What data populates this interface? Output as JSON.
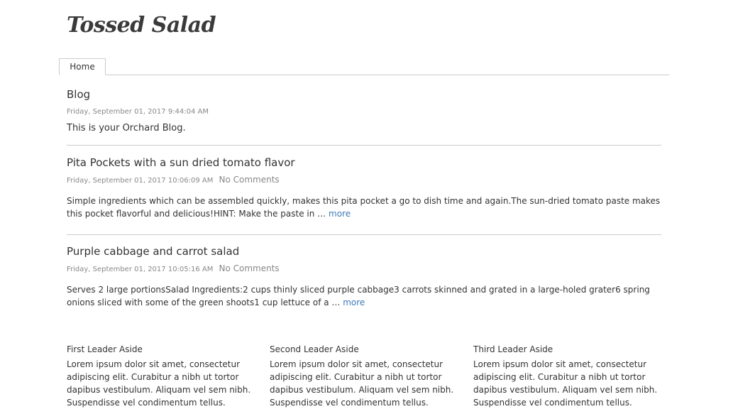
{
  "site": {
    "title": "Tossed Salad"
  },
  "nav": {
    "tabs": [
      {
        "label": "Home"
      }
    ]
  },
  "blog": {
    "title": "Blog",
    "date": "Friday, September 01, 2017 9:44:04 AM",
    "description": "This is your Orchard Blog."
  },
  "posts": [
    {
      "title": "Pita Pockets with a sun dried tomato flavor",
      "date": "Friday, September 01, 2017 10:06:09 AM",
      "comments": "No Comments",
      "excerpt": "Simple ingredients which can be assembled quickly, makes this pita pocket a go to dish time and again.The sun-dried tomato paste makes this pocket flavorful and delicious!HINT:  Make the paste in … ",
      "more": "more"
    },
    {
      "title": "Purple cabbage and carrot salad",
      "date": "Friday, September 01, 2017 10:05:16 AM",
      "comments": "No Comments",
      "excerpt": "Serves 2 large portionsSalad Ingredients:2 cups thinly sliced purple cabbage3 carrots skinned and grated in a large-holed grater6 spring onions sliced with some of the green shoots1 cup lettuce of a … ",
      "more": "more"
    }
  ],
  "asides": [
    {
      "title": "First Leader Aside",
      "body": "Lorem ipsum dolor sit amet, consectetur adipiscing elit. Curabitur a nibh ut tortor dapibus vestibulum. Aliquam vel sem nibh. Suspendisse vel condimentum tellus."
    },
    {
      "title": "Second Leader Aside",
      "body": "Lorem ipsum dolor sit amet, consectetur adipiscing elit. Curabitur a nibh ut tortor dapibus vestibulum. Aliquam vel sem nibh. Suspendisse vel condimentum tellus."
    },
    {
      "title": "Third Leader Aside",
      "body": "Lorem ipsum dolor sit amet, consectetur adipiscing elit. Curabitur a nibh ut tortor dapibus vestibulum. Aliquam vel sem nibh. Suspendisse vel condimentum tellus."
    }
  ],
  "colors": {
    "link": "#3d7ab8",
    "meta": "#888888",
    "divider": "#cccccc",
    "text": "#333333"
  }
}
